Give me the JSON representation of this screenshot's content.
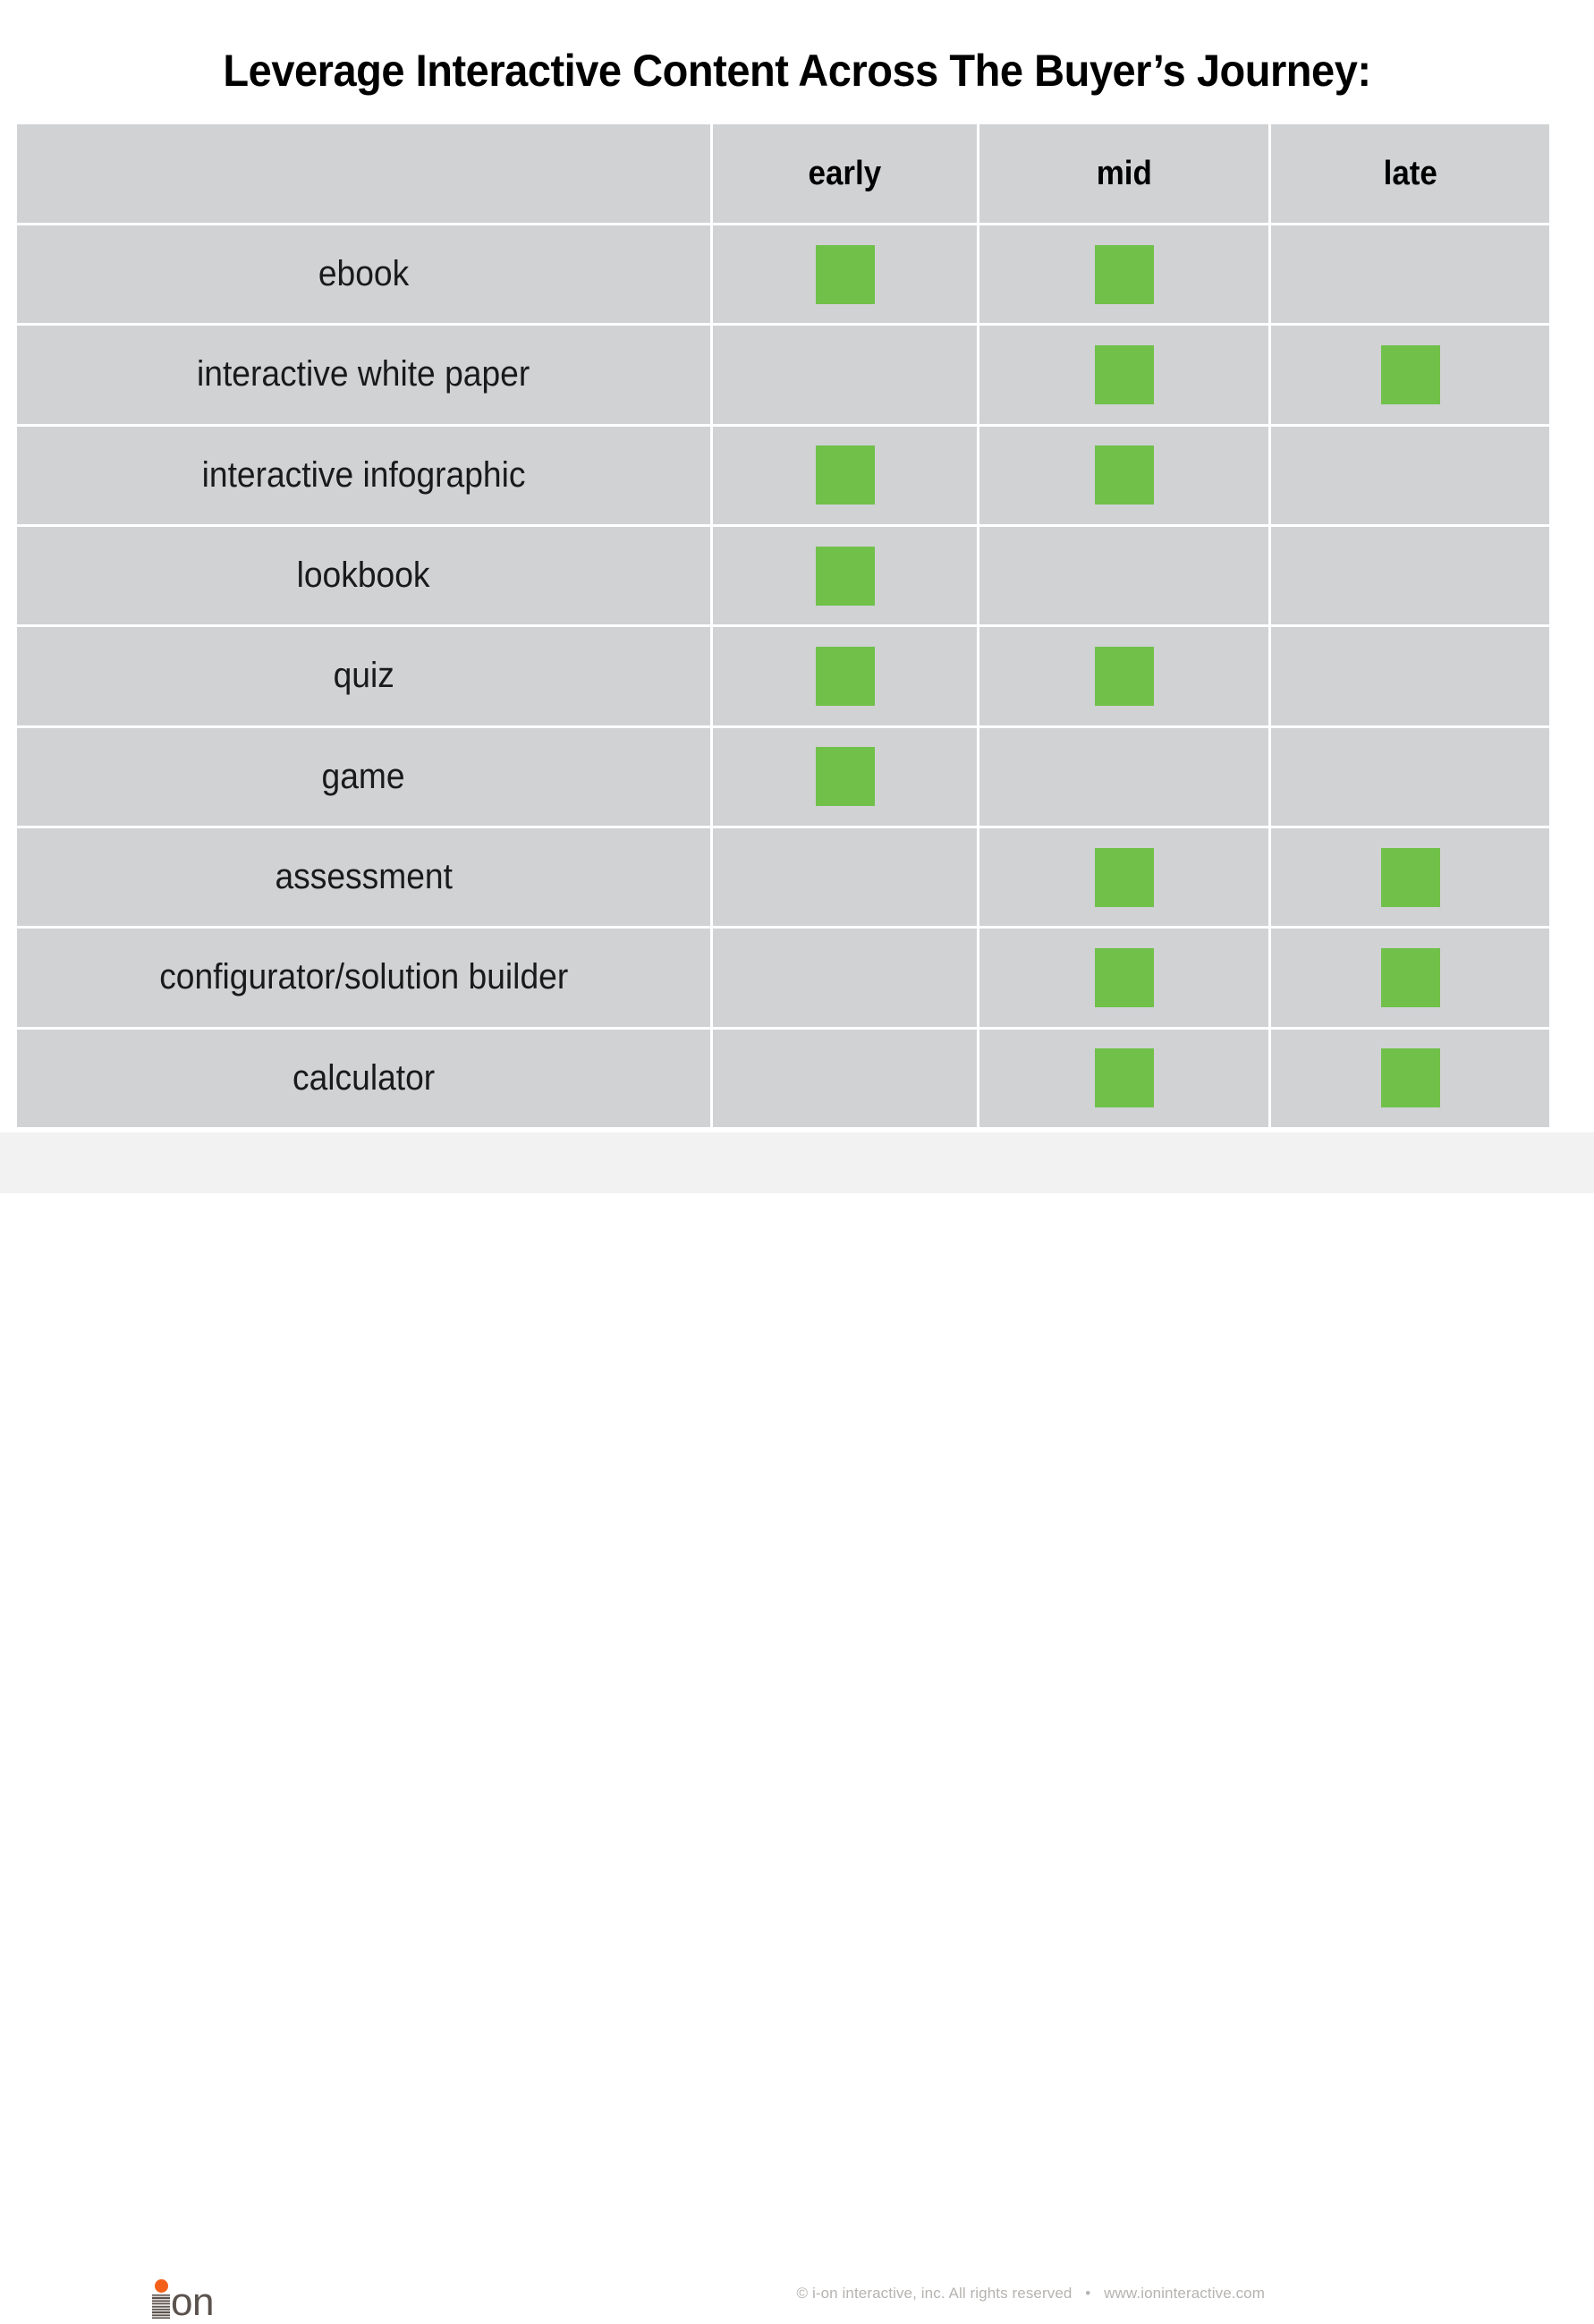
{
  "title": "Leverage Interactive Content Across The Buyer’s Journey:",
  "table": {
    "corner_label": "",
    "columns": [
      {
        "key": "early",
        "label": "early"
      },
      {
        "key": "mid",
        "label": "mid"
      },
      {
        "key": "late",
        "label": "late"
      }
    ],
    "rows": [
      {
        "label": "ebook",
        "early": true,
        "mid": true,
        "late": false
      },
      {
        "label": "interactive white paper",
        "early": false,
        "mid": true,
        "late": true
      },
      {
        "label": "interactive infographic",
        "early": true,
        "mid": true,
        "late": false
      },
      {
        "label": "lookbook",
        "early": true,
        "mid": false,
        "late": false
      },
      {
        "label": "quiz",
        "early": true,
        "mid": true,
        "late": false
      },
      {
        "label": "game",
        "early": true,
        "mid": false,
        "late": false
      },
      {
        "label": "assessment",
        "early": false,
        "mid": true,
        "late": true
      },
      {
        "label": "configurator/solution builder",
        "early": false,
        "mid": true,
        "late": true
      },
      {
        "label": "calculator",
        "early": false,
        "mid": true,
        "late": true
      }
    ]
  },
  "colors": {
    "mark": "#70c04a",
    "table_background": "#d0d2d4",
    "grid_line": "#ffffff",
    "logo_dot": "#f4601a",
    "logo_text": "#5b524e",
    "footer_background": "#f2f2f2",
    "footer_text": "#b6b3b0"
  },
  "footer": {
    "logo_text": "on",
    "copyright": "© i-on interactive, inc. All rights reserved",
    "separator": "•",
    "website": "www.ioninteractive.com"
  }
}
